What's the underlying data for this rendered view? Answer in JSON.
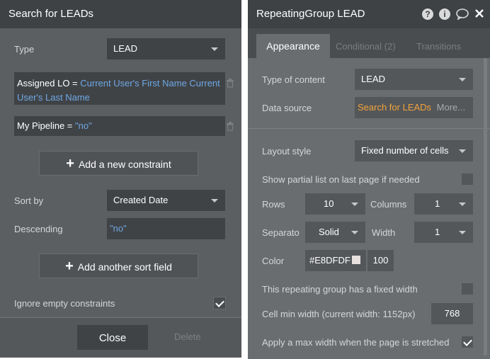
{
  "left_panel": {
    "title": "Search for LEADs",
    "type_label": "Type",
    "type_value": "LEAD",
    "constraints": [
      {
        "field": "Assigned LO = ",
        "value": "Current User's First Name Current User's Last Name"
      },
      {
        "field": "My Pipeline = ",
        "value": "\"no\""
      }
    ],
    "add_constraint_label": "Add a new constraint",
    "sort_by_label": "Sort by",
    "sort_by_value": "Created Date",
    "descending_label": "Descending",
    "descending_value": "\"no\"",
    "add_sort_label": "Add another sort field",
    "ignore_empty_label": "Ignore empty constraints",
    "ignore_empty_checked": true,
    "close_label": "Close",
    "delete_label": "Delete"
  },
  "right_panel": {
    "title": "RepeatingGroup LEAD",
    "tabs": [
      "Appearance",
      "Conditional (2)",
      "Transitions"
    ],
    "active_tab": "Appearance",
    "type_of_content_label": "Type of content",
    "type_of_content_value": "LEAD",
    "data_source_label": "Data source",
    "data_source_value": "Search for LEADs",
    "data_source_more": "More...",
    "layout_style_label": "Layout style",
    "layout_style_value": "Fixed number of cells",
    "partial_list_label": "Show partial list on last page if needed",
    "partial_list_checked": false,
    "rows_label": "Rows",
    "rows_value": "10",
    "columns_label": "Columns",
    "columns_value": "1",
    "separator_label": "Separato",
    "separator_value": "Solid",
    "width_label": "Width",
    "width_value": "1",
    "color_label": "Color",
    "color_hex": "#E8DFDF",
    "color_opacity": "100",
    "fixed_width_label": "This repeating group has a fixed width",
    "fixed_width_checked": false,
    "cell_min_width_label": "Cell min width (current width: 1152px)",
    "cell_min_width_value": "768",
    "max_width_label": "Apply a max width when the page is stretched",
    "max_width_checked": true
  },
  "icons": [
    "help-icon",
    "info-icon",
    "comment-icon",
    "close-icon",
    "trash-icon",
    "plus-icon",
    "checkmark-icon",
    "chevron-down-icon"
  ]
}
